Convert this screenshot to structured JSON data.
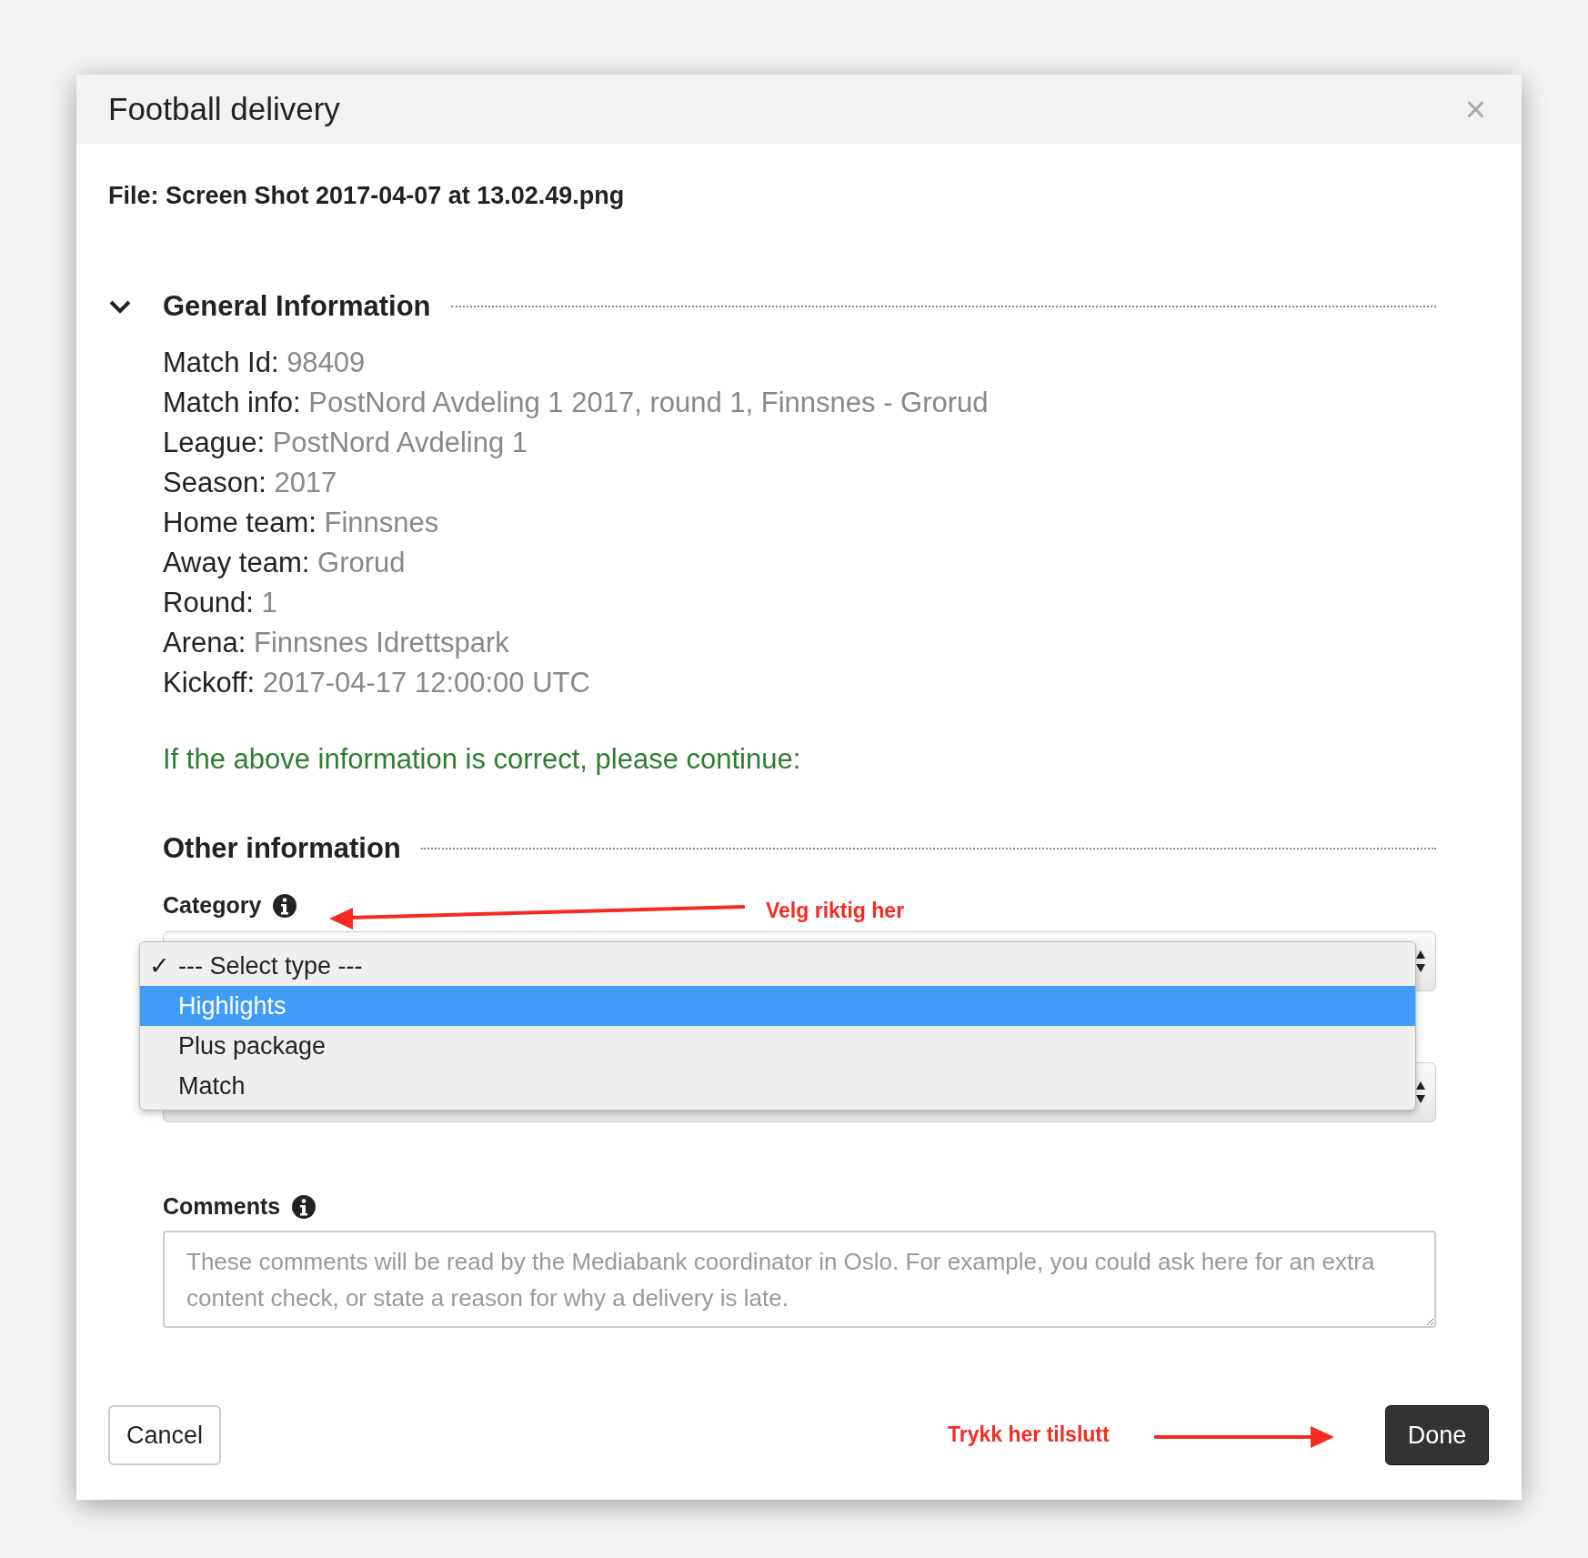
{
  "dialog": {
    "title": "Football delivery",
    "close": "×"
  },
  "file": {
    "label": "File:",
    "name": "Screen Shot 2017-04-07 at 13.02.49.png"
  },
  "general": {
    "title": "General Information",
    "expanded": true,
    "fields": [
      {
        "label": "Match Id:",
        "value": "98409"
      },
      {
        "label": "Match info:",
        "value": "PostNord Avdeling 1 2017, round 1, Finnsnes - Grorud"
      },
      {
        "label": "League:",
        "value": "PostNord Avdeling 1"
      },
      {
        "label": "Season:",
        "value": "2017"
      },
      {
        "label": "Home team:",
        "value": "Finnsnes"
      },
      {
        "label": "Away team:",
        "value": "Grorud"
      },
      {
        "label": "Round:",
        "value": "1"
      },
      {
        "label": "Arena:",
        "value": "Finnsnes Idrettspark"
      },
      {
        "label": "Kickoff:",
        "value": "2017-04-17 12:00:00 UTC"
      }
    ]
  },
  "notice": "If the above information is correct, please continue:",
  "other": {
    "title": "Other information",
    "category_label": "Category",
    "options": [
      {
        "label": "--- Select type ---",
        "checked": true,
        "selected": false
      },
      {
        "label": "Highlights",
        "checked": false,
        "selected": true
      },
      {
        "label": "Plus package",
        "checked": false,
        "selected": false
      },
      {
        "label": "Match",
        "checked": false,
        "selected": false
      }
    ],
    "check_mark": "✓",
    "comments_label": "Comments",
    "comments_placeholder": "These comments will be read by the Mediabank coordinator in Oslo. For example, you could ask here for an extra content check, or state a reason for why a delivery is late."
  },
  "buttons": {
    "cancel": "Cancel",
    "done": "Done"
  },
  "annotations": [
    "Velg riktig her",
    "Trykk her tilslutt"
  ]
}
